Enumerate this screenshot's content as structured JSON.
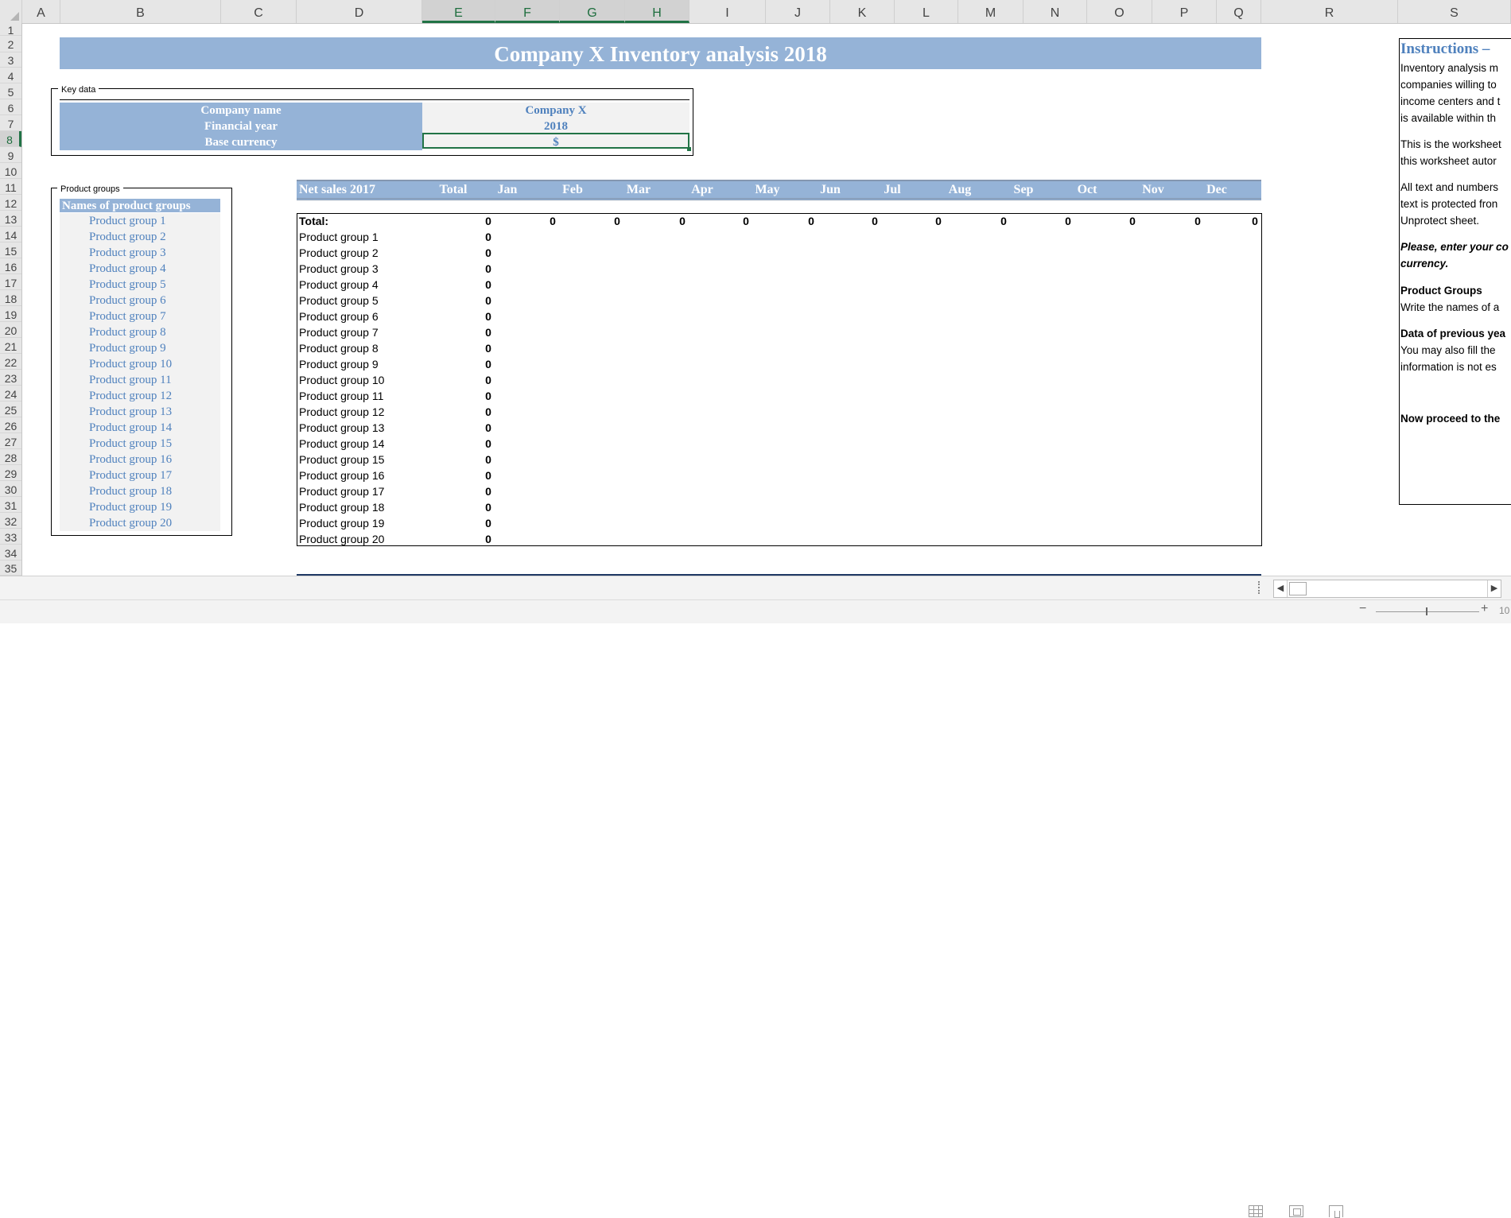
{
  "columns": [
    "A",
    "B",
    "C",
    "D",
    "E",
    "F",
    "G",
    "H",
    "I",
    "J",
    "K",
    "L",
    "M",
    "N",
    "O",
    "P",
    "Q",
    "R",
    "S"
  ],
  "rows": [
    "1",
    "2",
    "3",
    "4",
    "5",
    "6",
    "7",
    "8",
    "9",
    "10",
    "11",
    "12",
    "13",
    "14",
    "15",
    "16",
    "17",
    "18",
    "19",
    "20",
    "21",
    "22",
    "23",
    "24",
    "25",
    "26",
    "27",
    "28",
    "29",
    "30",
    "31",
    "32",
    "33",
    "34",
    "35"
  ],
  "title": "Company X Inventory analysis 2018",
  "key_data": {
    "title": "Key data",
    "company_name_label": "Company name",
    "company_name_value": "Company X",
    "financial_year_label": "Financial year",
    "financial_year_value": "2018",
    "base_currency_label": "Base currency",
    "base_currency_value": "$"
  },
  "product_groups": {
    "title": "Product groups",
    "header": "Names of product groups",
    "items": [
      "Product group 1",
      "Product group 2",
      "Product group 3",
      "Product group 4",
      "Product group 5",
      "Product group 6",
      "Product group 7",
      "Product group 8",
      "Product group 9",
      "Product group 10",
      "Product group 11",
      "Product group 12",
      "Product group 13",
      "Product group 14",
      "Product group 15",
      "Product group 16",
      "Product group 17",
      "Product group 18",
      "Product group 19",
      "Product group 20"
    ]
  },
  "net_sales": {
    "header": "Net sales 2017",
    "total_header": "Total",
    "months": [
      "Jan",
      "Feb",
      "Mar",
      "Apr",
      "May",
      "Jun",
      "Jul",
      "Aug",
      "Sep",
      "Oct",
      "Nov",
      "Dec"
    ],
    "total_label": "Total:",
    "total_value": "0",
    "month_totals": [
      "0",
      "0",
      "0",
      "0",
      "0",
      "0",
      "0",
      "0",
      "0",
      "0",
      "0",
      "0"
    ],
    "rows": [
      {
        "label": "Product group 1",
        "total": "0"
      },
      {
        "label": "Product group 2",
        "total": "0"
      },
      {
        "label": "Product group 3",
        "total": "0"
      },
      {
        "label": "Product group 4",
        "total": "0"
      },
      {
        "label": "Product group 5",
        "total": "0"
      },
      {
        "label": "Product group 6",
        "total": "0"
      },
      {
        "label": "Product group 7",
        "total": "0"
      },
      {
        "label": "Product group 8",
        "total": "0"
      },
      {
        "label": "Product group 9",
        "total": "0"
      },
      {
        "label": "Product group 10",
        "total": "0"
      },
      {
        "label": "Product group 11",
        "total": "0"
      },
      {
        "label": "Product group 12",
        "total": "0"
      },
      {
        "label": "Product group 13",
        "total": "0"
      },
      {
        "label": "Product group 14",
        "total": "0"
      },
      {
        "label": "Product group 15",
        "total": "0"
      },
      {
        "label": "Product group 16",
        "total": "0"
      },
      {
        "label": "Product group 17",
        "total": "0"
      },
      {
        "label": "Product group 18",
        "total": "0"
      },
      {
        "label": "Product group 19",
        "total": "0"
      },
      {
        "label": "Product group 20",
        "total": "0"
      }
    ]
  },
  "instructions": {
    "title": "Instructions –",
    "lines": [
      "Inventory analysis m",
      "companies willing to",
      "income centers and t",
      "is available within th",
      "This is the worksheet",
      "this worksheet autor",
      "All text and numbers",
      "text is protected fron",
      "Unprotect sheet.",
      "Please, enter your co",
      "currency.",
      "Product Groups",
      "Write the names of a",
      "Data of previous yea",
      "You may also fill the",
      "information is not es",
      "Now proceed to the"
    ]
  },
  "status": {
    "zoom_minus": "−",
    "zoom_plus": "+",
    "zoom_level": "10"
  },
  "colors": {
    "accent_blue": "#95b3d7",
    "value_blue": "#4f81bd",
    "excel_green": "#217346"
  }
}
